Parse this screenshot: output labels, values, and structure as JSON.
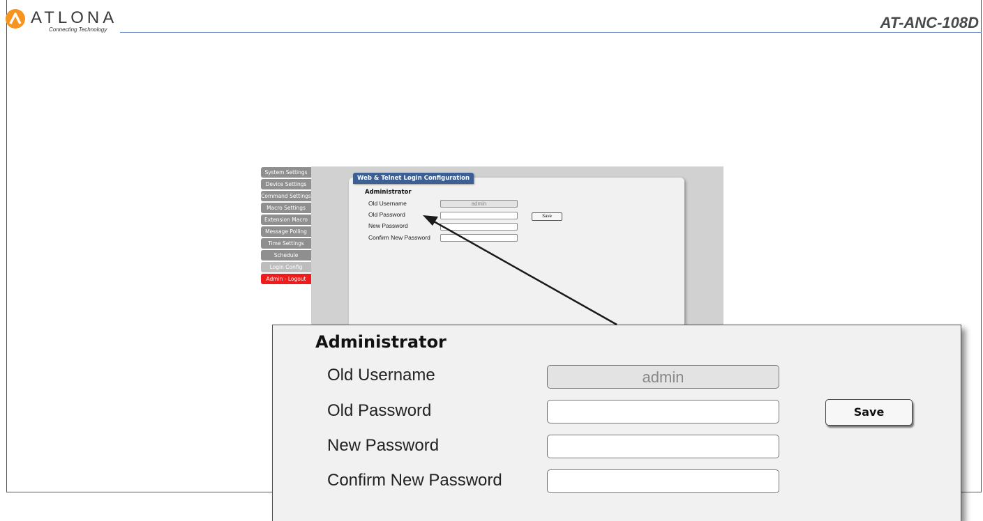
{
  "header": {
    "brand": "ATLONA",
    "tagline": "Connecting Technology",
    "model": "AT-ANC-108D"
  },
  "sidebar": {
    "items": [
      {
        "label": "System Settings"
      },
      {
        "label": "Device Settings"
      },
      {
        "label": "Command Settings"
      },
      {
        "label": "Macro Settings"
      },
      {
        "label": "Extension Macro"
      },
      {
        "label": "Message Polling"
      },
      {
        "label": "Time Settings"
      },
      {
        "label": "Schedule"
      },
      {
        "label": "Login Config"
      },
      {
        "label": "Admin - Logout"
      }
    ]
  },
  "panel": {
    "tab_title": "Web & Telnet Login Configuration",
    "section": "Administrator",
    "old_username_label": "Old Username",
    "old_username_value": "admin",
    "old_password_label": "Old Password",
    "new_password_label": "New Password",
    "confirm_password_label": "Confirm New Password",
    "save_label": "Save"
  },
  "colors": {
    "tab_blue": "#3d5f94",
    "logout_red": "#ee1c1c",
    "logo_orange": "#f7941d"
  }
}
